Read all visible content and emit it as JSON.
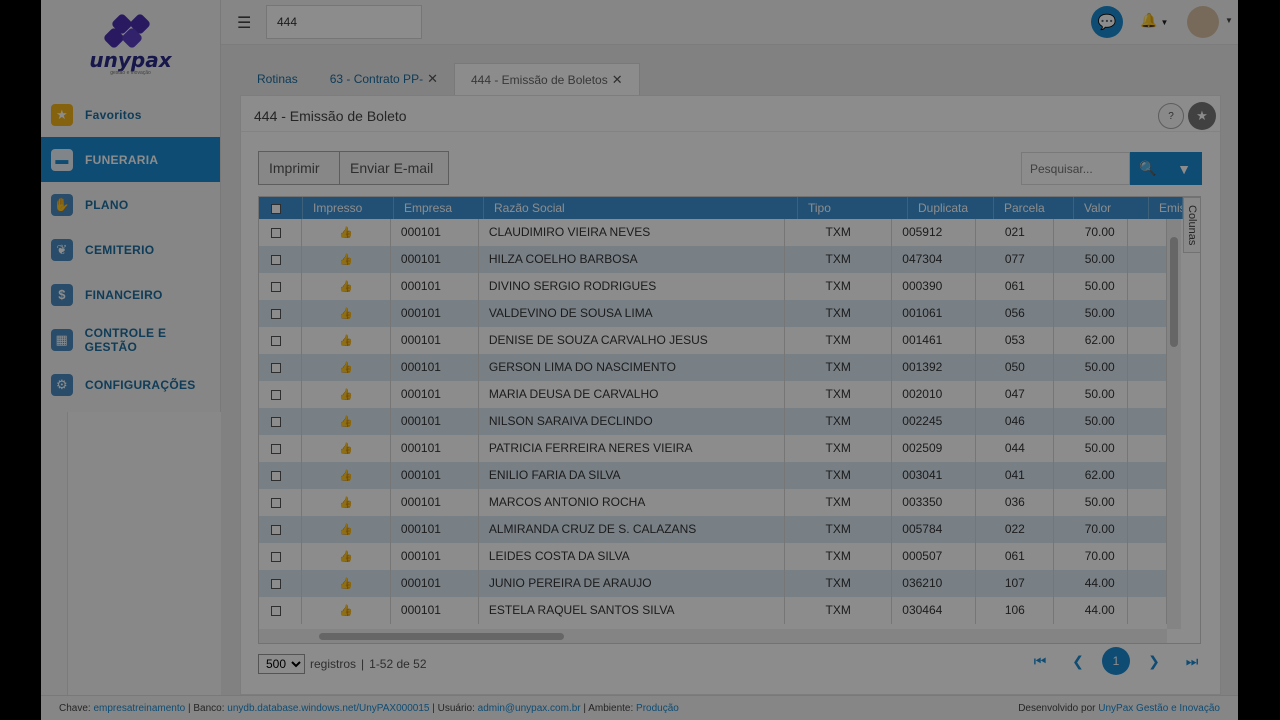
{
  "logo": {
    "name": "unypax",
    "tagline": "gestão e inovação"
  },
  "sidebar": {
    "items": [
      {
        "label": "Favoritos",
        "icon": "star-icon",
        "glyph": "★"
      },
      {
        "label": "FUNERARIA",
        "icon": "hearse-icon",
        "glyph": "▬"
      },
      {
        "label": "PLANO",
        "icon": "handshake-icon",
        "glyph": "✋"
      },
      {
        "label": "CEMITERIO",
        "icon": "plant-icon",
        "glyph": "❦"
      },
      {
        "label": "FINANCEIRO",
        "icon": "dollar-icon",
        "glyph": "$"
      },
      {
        "label": "CONTROLE E GESTÃO",
        "icon": "calculator-icon",
        "glyph": "▦"
      },
      {
        "label": "CONFIGURAÇÕES",
        "icon": "gear-icon",
        "glyph": "⚙"
      }
    ]
  },
  "topbar": {
    "search_value": "444"
  },
  "tabs": [
    {
      "label": "Rotinas"
    },
    {
      "label": "63 - Contrato PP-"
    },
    {
      "label": "444 - Emissão de Boletos"
    }
  ],
  "panel": {
    "title": "444 - Emissão de Boleto",
    "print_label": "Imprimir",
    "email_label": "Enviar E-mail",
    "search_placeholder": "Pesquisar...",
    "columns_label": "Colunas"
  },
  "grid": {
    "headers": [
      "Impresso",
      "Empresa",
      "Razão Social",
      "Tipo",
      "Duplicata",
      "Parcela",
      "Valor",
      "Emis"
    ],
    "rows": [
      [
        "000101",
        "CLAUDIMIRO VIEIRA NEVES",
        "TXM",
        "005912",
        "021",
        "70.00"
      ],
      [
        "000101",
        "HILZA COELHO BARBOSA",
        "TXM",
        "047304",
        "077",
        "50.00"
      ],
      [
        "000101",
        "DIVINO SERGIO RODRIGUES",
        "TXM",
        "000390",
        "061",
        "50.00"
      ],
      [
        "000101",
        "VALDEVINO DE SOUSA LIMA",
        "TXM",
        "001061",
        "056",
        "50.00"
      ],
      [
        "000101",
        "DENISE DE SOUZA CARVALHO JESUS",
        "TXM",
        "001461",
        "053",
        "62.00"
      ],
      [
        "000101",
        "GERSON LIMA DO NASCIMENTO",
        "TXM",
        "001392",
        "050",
        "50.00"
      ],
      [
        "000101",
        "MARIA DEUSA DE CARVALHO",
        "TXM",
        "002010",
        "047",
        "50.00"
      ],
      [
        "000101",
        "NILSON SARAIVA DECLINDO",
        "TXM",
        "002245",
        "046",
        "50.00"
      ],
      [
        "000101",
        "PATRICIA FERREIRA NERES VIEIRA",
        "TXM",
        "002509",
        "044",
        "50.00"
      ],
      [
        "000101",
        "ENILIO FARIA DA SILVA",
        "TXM",
        "003041",
        "041",
        "62.00"
      ],
      [
        "000101",
        "MARCOS ANTONIO ROCHA",
        "TXM",
        "003350",
        "036",
        "50.00"
      ],
      [
        "000101",
        "ALMIRANDA CRUZ DE S. CALAZANS",
        "TXM",
        "005784",
        "022",
        "70.00"
      ],
      [
        "000101",
        "LEIDES COSTA DA SILVA",
        "TXM",
        "000507",
        "061",
        "70.00"
      ],
      [
        "000101",
        "JUNIO PEREIRA DE ARAUJO",
        "TXM",
        "036210",
        "107",
        "44.00"
      ],
      [
        "000101",
        "ESTELA RAQUEL SANTOS SILVA",
        "TXM",
        "030464",
        "106",
        "44.00"
      ]
    ]
  },
  "pager": {
    "page_size": "500",
    "records_label": "registros",
    "range": "1-52 de 52",
    "current_page": "1"
  },
  "footer": {
    "chave_label": "Chave:",
    "chave_value": "empresatreinamento",
    "banco_label": "| Banco:",
    "banco_value": "unydb.database.windows.net/UnyPAX000015",
    "usuario_label": "| Usuário:",
    "usuario_value": "admin@unypax.com.br",
    "ambiente_label": "| Ambiente:",
    "ambiente_value": "Produção",
    "dev_label": "Desenvolvido por",
    "dev_value": "UnyPax Gestão e Inovação"
  },
  "colors": {
    "accent": "#1b8bd1",
    "header": "#3e93d3",
    "alt_row": "#dbe9f5",
    "star": "#f3b31a"
  }
}
